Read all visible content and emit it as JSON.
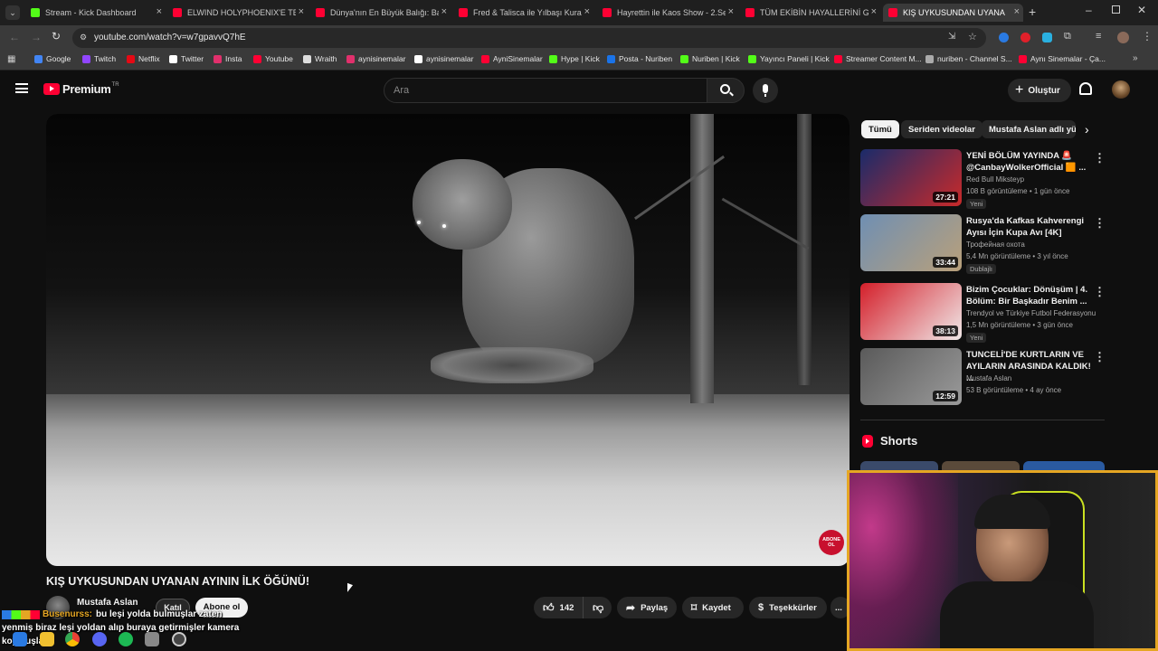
{
  "tabs": [
    {
      "label": "Stream - Kick Dashboard",
      "color": "#53fc18"
    },
    {
      "label": "ELWIND HOLYPHOENIX'E TEK A",
      "color": "#ff0033"
    },
    {
      "label": "Dünya'nın En Büyük Balığı: Bal",
      "color": "#ff0033"
    },
    {
      "label": "Fred & Talisca ile Yılbaşı Kurab",
      "color": "#ff0033"
    },
    {
      "label": "Hayrettin ile Kaos Show - 2.Sez",
      "color": "#ff0033"
    },
    {
      "label": "TÜM EKİBİN HAYALLERİNİ GER",
      "color": "#ff0033"
    },
    {
      "label": "KIŞ UYKUSUNDAN UYANA",
      "color": "#ff0033"
    }
  ],
  "url": "youtube.com/watch?v=w7gpavvQ7hE",
  "bookmarks": [
    {
      "label": "Google",
      "color": "#4285f4"
    },
    {
      "label": "Twitch",
      "color": "#9146ff"
    },
    {
      "label": "Netflix",
      "color": "#e50914"
    },
    {
      "label": "Twitter",
      "color": "#ffffff"
    },
    {
      "label": "Insta",
      "color": "#e1306c"
    },
    {
      "label": "Youtube",
      "color": "#ff0033"
    },
    {
      "label": "Wraith",
      "color": "#dddddd"
    },
    {
      "label": "aynisinemalar",
      "color": "#e1306c"
    },
    {
      "label": "aynisinemalar",
      "color": "#ffffff"
    },
    {
      "label": "AyniSinemalar",
      "color": "#ff0033"
    },
    {
      "label": "Hype | Kick",
      "color": "#53fc18"
    },
    {
      "label": "Posta - Nuriben",
      "color": "#1a73e8"
    },
    {
      "label": "Nuriben | Kick",
      "color": "#53fc18"
    },
    {
      "label": "Yayıncı Paneli | Kick",
      "color": "#53fc18"
    },
    {
      "label": "Streamer Content M...",
      "color": "#ff0033"
    },
    {
      "label": "nuriben - Channel S...",
      "color": "#aaaaaa"
    },
    {
      "label": "Aynı Sinemalar - Ça...",
      "color": "#ff0033"
    }
  ],
  "header": {
    "logo_text": "Premium",
    "region": "TR",
    "search_placeholder": "Ara",
    "create_label": "Oluştur"
  },
  "filters": [
    "Tümü",
    "Seriden videolar",
    "Mustafa Aslan adlı yü"
  ],
  "video": {
    "title": "KIŞ UYKUSUNDAN UYANAN AYININ İLK ÖĞÜNÜ!",
    "watermark": "ABONE OL"
  },
  "channel": {
    "name": "Mustafa Aslan",
    "join_label": "Katıl",
    "subscribe_label": "Abone ol"
  },
  "actions": {
    "likes": "142",
    "share_label": "Paylaş",
    "save_label": "Kaydet",
    "thanks_label": "Teşekkürler",
    "more_label": "..."
  },
  "recommendations": [
    {
      "title": "YENİ BÖLÜM YAYINDA 🚨 @CanbayWolkerOfficial 🟧 ...",
      "channel": "Red Bull Miksteyp",
      "meta": "108 B görüntüleme • 1 gün önce",
      "badge": "Yeni",
      "duration": "27:21",
      "colors": [
        "#1a2b6a",
        "#c92a2a"
      ]
    },
    {
      "title": "Rusya'da Kafkas Kahverengi Ayısı İçin Kupa Avı [4K]",
      "channel": "Трофейная охота",
      "meta": "5,4 Mn görüntüleme • 3 yıl önce",
      "badge": "Dublajlı",
      "duration": "33:44",
      "colors": [
        "#6f8fb3",
        "#b9a07a"
      ]
    },
    {
      "title": "Bizim Çocuklar: Dönüşüm | 4. Bölüm: Bir Başkadır Benim ...",
      "channel": "Trendyol ve Türkiye Futbol Federasyonu",
      "meta": "1,5 Mn görüntüleme • 3 gün önce",
      "badge": "Yeni",
      "duration": "38:13",
      "colors": [
        "#d41f2a",
        "#f0e8e8"
      ]
    },
    {
      "title": "TUNCELİ'DE KURTLARIN VE AYILARIN ARASINDA KALDIK! ...",
      "channel": "Mustafa Aslan",
      "meta": "53 B görüntüleme • 4 ay önce",
      "badge": "",
      "duration": "12:59",
      "colors": [
        "#5a5a5a",
        "#9a9a9a"
      ]
    }
  ],
  "shorts_label": "Shorts",
  "chat": {
    "user": "Busenurss:",
    "line1": "bu leşi yolda bulmuşlar zaten",
    "line2": "yenmiş biraz leşi yoldan alıp buraya getirmişler kamera",
    "line3": "koymuşlar"
  }
}
